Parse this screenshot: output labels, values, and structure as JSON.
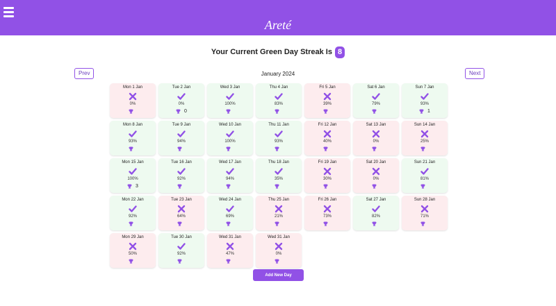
{
  "app": {
    "title": "Areté",
    "accent": "#9151e6",
    "green_bg": "#eefaf0",
    "red_bg": "#fdecee"
  },
  "streak": {
    "label": "Your Current Green Day Streak Is",
    "value": "8"
  },
  "calendar": {
    "month": "January 2024",
    "prev_label": "Prev",
    "next_label": "Next"
  },
  "add_button_label": "Add New Day",
  "days": [
    {
      "date": "Mon 1 Jan",
      "status": "red",
      "icon": "cross-icon",
      "pct": "0%",
      "trophies": ""
    },
    {
      "date": "Tue 2 Jan",
      "status": "green",
      "icon": "check-icon",
      "pct": "0%",
      "trophies": "0"
    },
    {
      "date": "Wed 3 Jan",
      "status": "green",
      "icon": "check-icon",
      "pct": "100%",
      "trophies": ""
    },
    {
      "date": "Thu 4 Jan",
      "status": "green",
      "icon": "check-icon",
      "pct": "83%",
      "trophies": ""
    },
    {
      "date": "Fri 5 Jan",
      "status": "red",
      "icon": "cross-icon",
      "pct": "39%",
      "trophies": ""
    },
    {
      "date": "Sat 6 Jan",
      "status": "green",
      "icon": "check-icon",
      "pct": "79%",
      "trophies": ""
    },
    {
      "date": "Sun 7 Jan",
      "status": "green",
      "icon": "check-icon",
      "pct": "93%",
      "trophies": "1"
    },
    {
      "date": "Mon 8 Jan",
      "status": "green",
      "icon": "check-icon",
      "pct": "93%",
      "trophies": ""
    },
    {
      "date": "Tue 9 Jan",
      "status": "green",
      "icon": "check-icon",
      "pct": "94%",
      "trophies": ""
    },
    {
      "date": "Wed 10 Jan",
      "status": "green",
      "icon": "check-icon",
      "pct": "100%",
      "trophies": ""
    },
    {
      "date": "Thu 11 Jan",
      "status": "green",
      "icon": "check-icon",
      "pct": "93%",
      "trophies": ""
    },
    {
      "date": "Fri 12 Jan",
      "status": "red",
      "icon": "cross-icon",
      "pct": "40%",
      "trophies": ""
    },
    {
      "date": "Sat 13 Jan",
      "status": "red",
      "icon": "cross-icon",
      "pct": "0%",
      "trophies": ""
    },
    {
      "date": "Sun 14 Jan",
      "status": "red",
      "icon": "cross-icon",
      "pct": "25%",
      "trophies": ""
    },
    {
      "date": "Mon 15 Jan",
      "status": "green",
      "icon": "check-icon",
      "pct": "100%",
      "trophies": "3"
    },
    {
      "date": "Tue 16 Jan",
      "status": "green",
      "icon": "check-icon",
      "pct": "92%",
      "trophies": ""
    },
    {
      "date": "Wed 17 Jan",
      "status": "green",
      "icon": "check-icon",
      "pct": "94%",
      "trophies": ""
    },
    {
      "date": "Thu 18 Jan",
      "status": "green",
      "icon": "check-icon",
      "pct": "35%",
      "trophies": ""
    },
    {
      "date": "Fri 19 Jan",
      "status": "red",
      "icon": "cross-icon",
      "pct": "30%",
      "trophies": ""
    },
    {
      "date": "Sat 20 Jan",
      "status": "red",
      "icon": "cross-icon",
      "pct": "0%",
      "trophies": ""
    },
    {
      "date": "Sun 21 Jan",
      "status": "green",
      "icon": "check-icon",
      "pct": "81%",
      "trophies": ""
    },
    {
      "date": "Mon 22 Jan",
      "status": "green",
      "icon": "check-icon",
      "pct": "92%",
      "trophies": ""
    },
    {
      "date": "Tue 23 Jan",
      "status": "red",
      "icon": "cross-icon",
      "pct": "64%",
      "trophies": ""
    },
    {
      "date": "Wed 24 Jan",
      "status": "green",
      "icon": "check-icon",
      "pct": "69%",
      "trophies": ""
    },
    {
      "date": "Thu 25 Jan",
      "status": "red",
      "icon": "cross-icon",
      "pct": "21%",
      "trophies": ""
    },
    {
      "date": "Fri 26 Jan",
      "status": "red",
      "icon": "cross-icon",
      "pct": "73%",
      "trophies": ""
    },
    {
      "date": "Sat 27 Jan",
      "status": "green",
      "icon": "check-icon",
      "pct": "82%",
      "trophies": ""
    },
    {
      "date": "Sun 28 Jan",
      "status": "red",
      "icon": "cross-icon",
      "pct": "71%",
      "trophies": ""
    },
    {
      "date": "Mon 29 Jan",
      "status": "red",
      "icon": "cross-icon",
      "pct": "50%",
      "trophies": ""
    },
    {
      "date": "Tue 30 Jan",
      "status": "green",
      "icon": "check-icon",
      "pct": "92%",
      "trophies": ""
    },
    {
      "date": "Wed 31 Jan",
      "status": "red",
      "icon": "cross-icon",
      "pct": "47%",
      "trophies": ""
    },
    {
      "date": "Wed 31 Jan",
      "status": "red",
      "icon": "cross-icon",
      "pct": "0%",
      "trophies": ""
    }
  ]
}
